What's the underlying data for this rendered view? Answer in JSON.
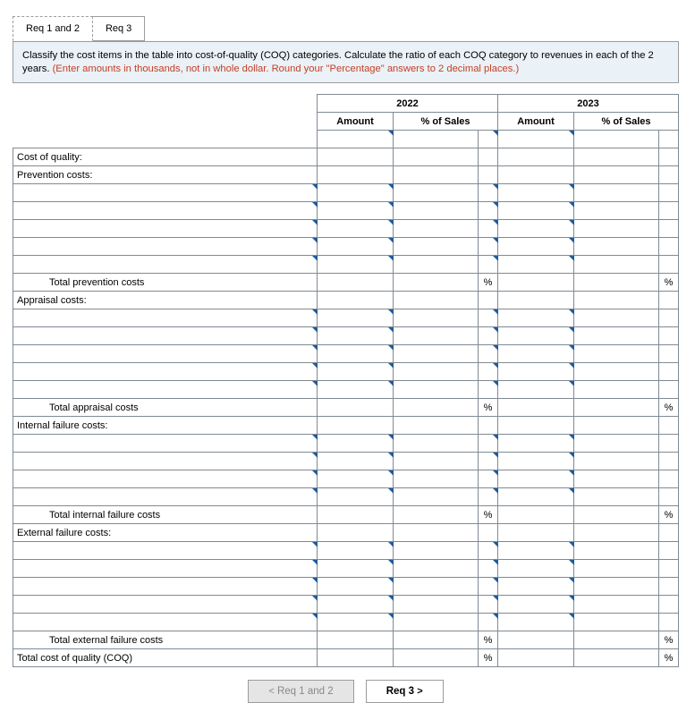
{
  "tabs": {
    "req12": "Req 1 and 2",
    "req3": "Req 3"
  },
  "instructions": {
    "main": "Classify the cost items in the table into cost-of-quality (COQ) categories. Calculate the ratio of each COQ category to revenues in each of the 2 years. ",
    "note": "(Enter amounts in thousands, not in whole dollar. Round your \"Percentage\" answers to 2 decimal places.)"
  },
  "headers": {
    "year1": "2022",
    "year2": "2023",
    "amount": "Amount",
    "pct": "% of Sales"
  },
  "rows": {
    "coq": "Cost of quality:",
    "prev": "Prevention costs:",
    "tot_prev": "Total prevention costs",
    "appraisal": "Appraisal costs:",
    "tot_appraisal": "Total appraisal costs",
    "ifc": "Internal failure costs:",
    "tot_ifc": "Total internal failure costs",
    "efc": "External failure costs:",
    "tot_efc": "Total external failure costs",
    "tot_coq": "Total cost of quality (COQ)"
  },
  "pct_symbol": "%",
  "nav": {
    "prev": "Req 1 and 2",
    "next": "Req 3"
  }
}
